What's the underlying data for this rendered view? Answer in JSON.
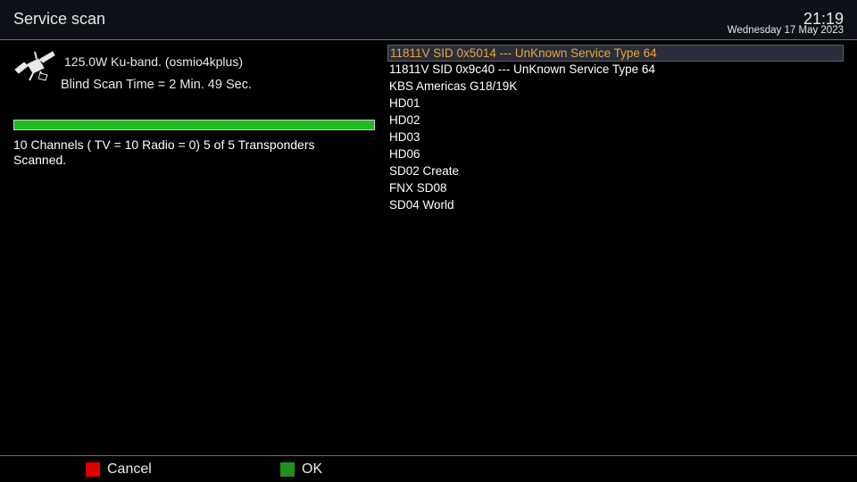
{
  "header": {
    "title": "Service scan",
    "time": "21:19",
    "date": "Wednesday 17 May 2023"
  },
  "scan": {
    "satellite_line": "125.0W Ku-band.  (osmio4kplus)",
    "blind_scan_time": "Blind Scan Time = 2 Min.  49 Sec.",
    "progress_fraction": 1.0,
    "status": "10 Channels ( TV = 10  Radio = 0)  5 of 5 Transponders Scanned."
  },
  "services": [
    "11811V SID 0x5014 --- UnKnown Service Type 64",
    "11811V SID 0x9c40 --- UnKnown Service Type 64",
    "KBS Americas G18/19K",
    "HD01",
    "HD02",
    "HD03",
    "HD06",
    "SD02 Create",
    "FNX SD08",
    "SD04 World"
  ],
  "selected_index": 0,
  "footer": {
    "cancel_label": "Cancel",
    "ok_label": "OK"
  },
  "colors": {
    "selected_text": "#e8a73a",
    "progress": "#1fbd1f",
    "red_key": "#e00000",
    "green_key": "#1f8f1f"
  },
  "icons": {
    "satellite": "satellite-icon"
  }
}
